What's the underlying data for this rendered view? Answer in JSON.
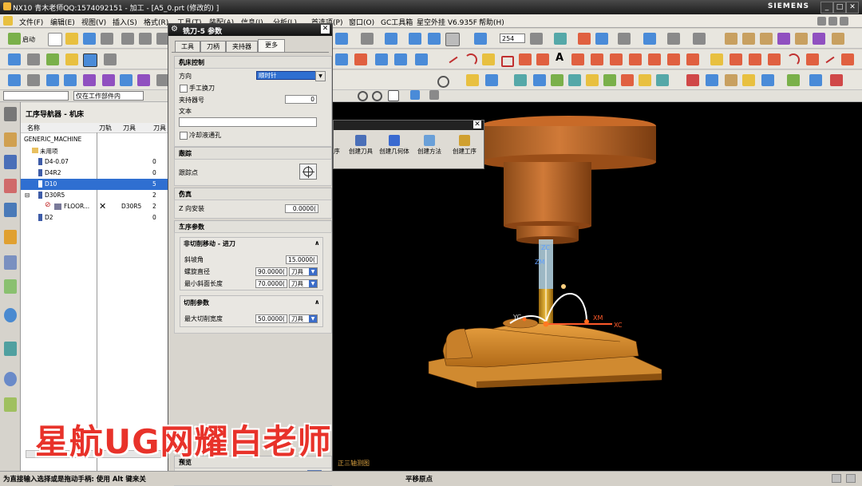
{
  "titlebar": {
    "title": "NX10 青木老师QQ:1574092151 - 加工 - [A5_0.prt (修改的) ]",
    "brand": "SIEMENS"
  },
  "menubar": {
    "items": [
      "文件(F)",
      "编辑(E)",
      "视图(V)",
      "插入(S)",
      "格式(R)",
      "工具(T)",
      "装配(A)",
      "信息(I)",
      "分析(L)",
      "首选项(P)",
      "窗口(O)",
      "GC工具箱",
      "星空外挂 V6.935F",
      "帮助(H)"
    ]
  },
  "toolbar": {
    "start_label": "启动",
    "layer_value": "254",
    "filter_value": "仅在工作部件内"
  },
  "navigator": {
    "title": "工序导航器 - 机床",
    "columns": [
      "名称",
      "刀轨",
      "刀具",
      "刀具"
    ],
    "rows": [
      {
        "name": "GENERIC_MACHINE",
        "path": "",
        "tool": "",
        "num": ""
      },
      {
        "name": "未用项",
        "path": "",
        "tool": "",
        "num": ""
      },
      {
        "name": "D4-0.07",
        "path": "",
        "tool": "",
        "num": "0"
      },
      {
        "name": "D4R2",
        "path": "",
        "tool": "",
        "num": "0"
      },
      {
        "name": "D10",
        "path": "",
        "tool": "",
        "num": "5"
      },
      {
        "name": "D30R5",
        "path": "",
        "tool": "",
        "num": "2"
      },
      {
        "name": "FLOOR...",
        "path": "✕",
        "tool": "D30R5",
        "num": "2"
      },
      {
        "name": "D2",
        "path": "",
        "tool": "",
        "num": "0"
      }
    ]
  },
  "dialog": {
    "title": "铣刀-5 参数",
    "tabs": [
      "工具",
      "刀柄",
      "夹持器",
      "更多"
    ],
    "machine_control": {
      "header": "机床控制",
      "direction_label": "方向",
      "direction_value": "顺时针",
      "manual_change_label": "手工换刀",
      "holder_no_label": "夹持器号",
      "holder_no_value": "0",
      "text_label": "文本",
      "coolant_label": "冷却液通孔"
    },
    "tracking": {
      "header": "跟踪",
      "point_label": "跟踪点"
    },
    "simulation": {
      "header": "仿真",
      "z_label": "Z 向安装",
      "z_value": "0.0000("
    },
    "operation": {
      "header": "工序参数",
      "noncut_header": "非切削移动 - 进刀",
      "ramp_label": "斜坡角",
      "ramp_value": "15.0000(",
      "helix_label": "螺旋直径",
      "helix_value": "90.0000(",
      "helix_unit": "刀具",
      "minramp_label": "最小斜面长度",
      "minramp_value": "70.0000(",
      "minramp_unit": "刀具",
      "cut_header": "切削参数",
      "maxstep_label": "最大切削宽度",
      "maxstep_value": "50.0000(",
      "maxstep_unit": "刀具"
    },
    "preview": {
      "header": "预览",
      "check_label": "预览",
      "show_label": "显示"
    }
  },
  "floatbar": {
    "items": [
      "序",
      "创建刀具",
      "创建几何体",
      "创建方法",
      "创建工序"
    ]
  },
  "viewport": {
    "axis_labels": {
      "zc": "ZC",
      "zm": "ZM",
      "yc": "YC",
      "xm": "XM",
      "xc": "XC"
    },
    "view_label": "正三轴测图"
  },
  "status": {
    "left": "为直接输入选择或是拖动手柄: 使用 Alt 键来关",
    "middle": "平移原点"
  },
  "watermark": "星航UG网耀白老师"
}
